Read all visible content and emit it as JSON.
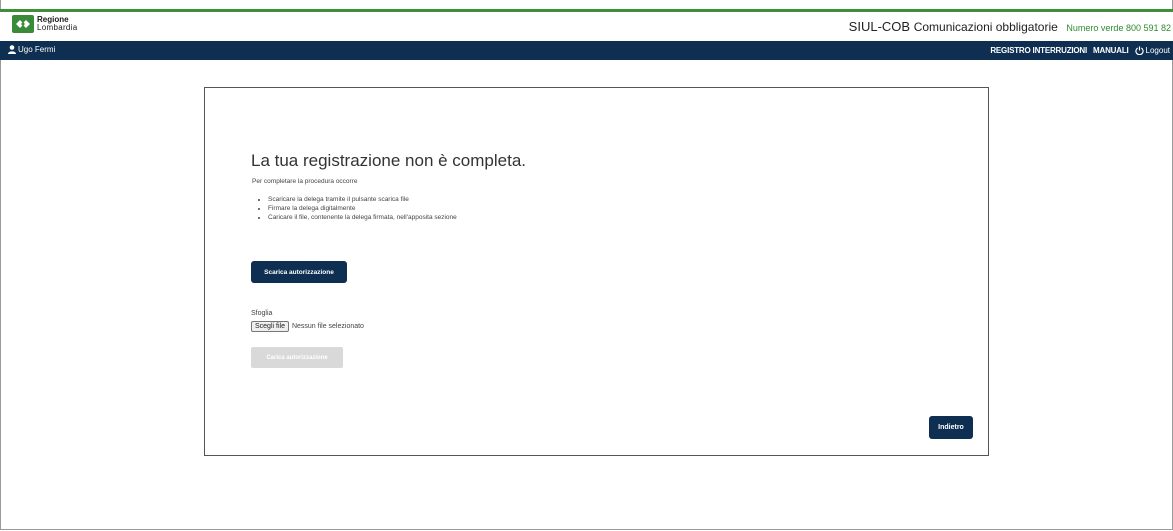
{
  "header": {
    "logo_line1": "Regione",
    "logo_line2": "Lombardia",
    "brand": "SIUL-COB",
    "app_name": "Comunicazioni obbligatorie",
    "phone": "Numero verde 800 591 82"
  },
  "navbar": {
    "user_name": "Ugo Fermi",
    "links": [
      "REGISTRO INTERRUZIONI",
      "MANUALI"
    ],
    "logout": "Logout"
  },
  "main": {
    "title": "La tua registrazione non è completa.",
    "intro": "Per completare la procedura occorre",
    "steps": [
      "Scaricare la delega tramite il pulsante scarica file",
      "Firmare la delega digitalmente",
      "Caricare il file, contenente la delega firmata, nell'apposita sezione"
    ],
    "download_button": "Scarica autorizzazione",
    "browse_label": "Sfoglia",
    "choose_file_button": "Scegli file",
    "no_file_text": "Nessun file selezionato",
    "upload_button": "Carica autorizzazione",
    "back_button": "Indietro"
  },
  "colors": {
    "navbar": "#0f2f52",
    "accent_green": "#3d8f3a",
    "primary_button": "#0f2f52",
    "disabled_button": "#d9d9d9"
  }
}
